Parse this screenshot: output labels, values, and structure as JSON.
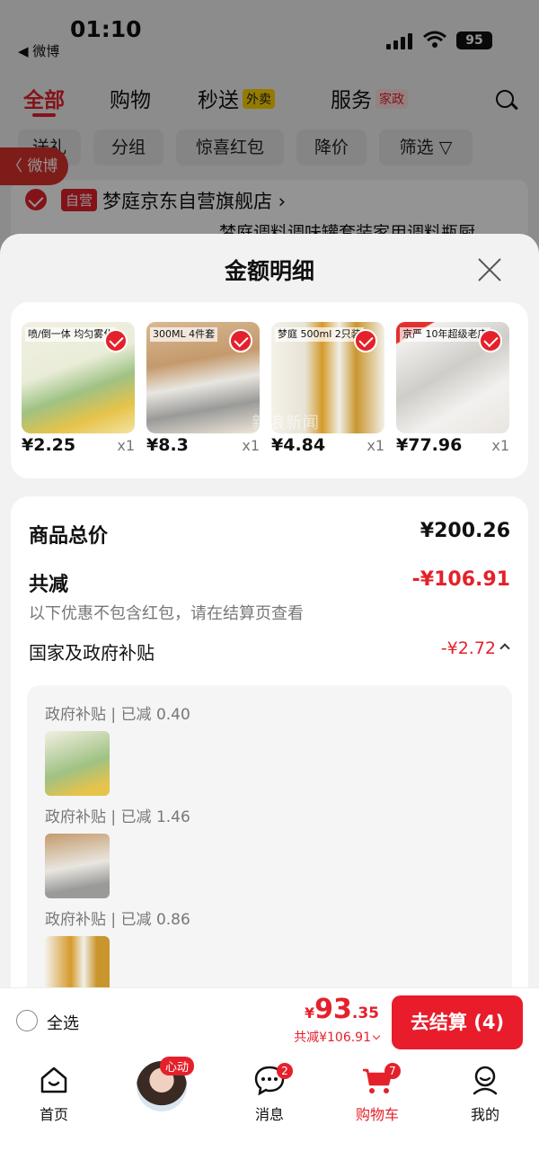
{
  "status": {
    "time": "01:10",
    "back_app": "◀ 微博",
    "battery": "95"
  },
  "top_tabs": [
    {
      "label": "全部"
    },
    {
      "label": "购物"
    },
    {
      "label": "秒送",
      "tag": "外卖"
    },
    {
      "label": "服务",
      "tag": "家政"
    }
  ],
  "filters": [
    "送礼",
    "分组",
    "惊喜红包",
    "降价",
    "筛选 ▽"
  ],
  "weibo_float": "〈 微博",
  "store": {
    "badge": "自营",
    "name": "梦庭京东自营旗舰店 ›",
    "product_preview": "梦庭调料调味罐套装家用调料瓶厨"
  },
  "sheet": {
    "title": "金额明细",
    "products": [
      {
        "price": "¥2.25",
        "qty": "x1",
        "tag": "喷/倒一体 均匀雾化"
      },
      {
        "price": "¥8.3",
        "qty": "x1",
        "tag": "300ML 4件套"
      },
      {
        "price": "¥4.84",
        "qty": "x1",
        "tag": "梦庭 500ml 2只装"
      },
      {
        "price": "¥77.96",
        "qty": "x1",
        "tag": "京严 10年超级老店"
      }
    ],
    "watermark": "新浪新闻",
    "total_label": "商品总价",
    "total_value": "¥200.26",
    "discount_label": "共减",
    "discount_value": "-¥106.91",
    "discount_hint": "以下优惠不包含红包，请在结算页查看",
    "subsidy_label": "国家及政府补贴",
    "subsidy_value": "-¥2.72",
    "gov_items": [
      {
        "text": "政府补贴 | 已减 0.40"
      },
      {
        "text": "政府补贴 | 已减 1.46"
      },
      {
        "text": "政府补贴 | 已减 0.86"
      }
    ]
  },
  "bottom": {
    "select_all": "全选",
    "yen": "¥",
    "price_int": "93",
    "price_dec": ".35",
    "discount": "共减¥106.91",
    "checkout": "去结算 (4)"
  },
  "nav": [
    {
      "label": "首页",
      "icon": "home-icon"
    },
    {
      "label": "",
      "icon": "avatar",
      "badge": "心动"
    },
    {
      "label": "消息",
      "icon": "message-icon",
      "badge": "2"
    },
    {
      "label": "购物车",
      "icon": "cart-icon",
      "badge": "7"
    },
    {
      "label": "我的",
      "icon": "profile-icon"
    }
  ],
  "colors": {
    "accent": "#e4212b",
    "overlay": "rgba(0,0,0,0.42)"
  }
}
